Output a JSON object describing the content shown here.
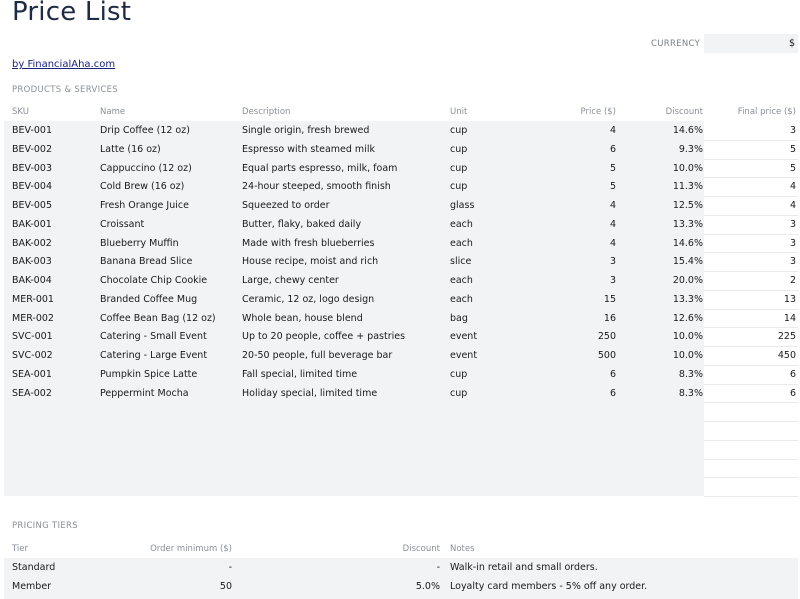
{
  "title": "Price List",
  "currency": {
    "label": "CURRENCY",
    "value": "$"
  },
  "byline": "by FinancialAha.com",
  "products_section_label": "PRODUCTS & SERVICES",
  "products_headers": {
    "sku": "SKU",
    "name": "Name",
    "description": "Description",
    "unit": "Unit",
    "price": "Price ($)",
    "discount": "Discount",
    "final": "Final price ($)"
  },
  "products": [
    {
      "sku": "BEV-001",
      "name": "Drip Coffee (12 oz)",
      "description": "Single origin, fresh brewed",
      "unit": "cup",
      "price": "4",
      "discount": "14.6%",
      "final": "3"
    },
    {
      "sku": "BEV-002",
      "name": "Latte (16 oz)",
      "description": "Espresso with steamed milk",
      "unit": "cup",
      "price": "6",
      "discount": "9.3%",
      "final": "5"
    },
    {
      "sku": "BEV-003",
      "name": "Cappuccino (12 oz)",
      "description": "Equal parts espresso, milk, foam",
      "unit": "cup",
      "price": "5",
      "discount": "10.0%",
      "final": "5"
    },
    {
      "sku": "BEV-004",
      "name": "Cold Brew (16 oz)",
      "description": "24-hour steeped, smooth finish",
      "unit": "cup",
      "price": "5",
      "discount": "11.3%",
      "final": "4"
    },
    {
      "sku": "BEV-005",
      "name": "Fresh Orange Juice",
      "description": "Squeezed to order",
      "unit": "glass",
      "price": "4",
      "discount": "12.5%",
      "final": "4"
    },
    {
      "sku": "BAK-001",
      "name": "Croissant",
      "description": "Butter, flaky, baked daily",
      "unit": "each",
      "price": "4",
      "discount": "13.3%",
      "final": "3"
    },
    {
      "sku": "BAK-002",
      "name": "Blueberry Muffin",
      "description": "Made with fresh blueberries",
      "unit": "each",
      "price": "4",
      "discount": "14.6%",
      "final": "3"
    },
    {
      "sku": "BAK-003",
      "name": "Banana Bread Slice",
      "description": "House recipe, moist and rich",
      "unit": "slice",
      "price": "3",
      "discount": "15.4%",
      "final": "3"
    },
    {
      "sku": "BAK-004",
      "name": "Chocolate Chip Cookie",
      "description": "Large, chewy center",
      "unit": "each",
      "price": "3",
      "discount": "20.0%",
      "final": "2"
    },
    {
      "sku": "MER-001",
      "name": "Branded Coffee Mug",
      "description": "Ceramic, 12 oz, logo design",
      "unit": "each",
      "price": "15",
      "discount": "13.3%",
      "final": "13"
    },
    {
      "sku": "MER-002",
      "name": "Coffee Bean Bag (12 oz)",
      "description": "Whole bean, house blend",
      "unit": "bag",
      "price": "16",
      "discount": "12.6%",
      "final": "14"
    },
    {
      "sku": "SVC-001",
      "name": "Catering - Small Event",
      "description": "Up to 20 people, coffee + pastries",
      "unit": "event",
      "price": "250",
      "discount": "10.0%",
      "final": "225"
    },
    {
      "sku": "SVC-002",
      "name": "Catering - Large Event",
      "description": "20-50 people, full beverage bar",
      "unit": "event",
      "price": "500",
      "discount": "10.0%",
      "final": "450"
    },
    {
      "sku": "SEA-001",
      "name": "Pumpkin Spice Latte",
      "description": "Fall special, limited time",
      "unit": "cup",
      "price": "6",
      "discount": "8.3%",
      "final": "6"
    },
    {
      "sku": "SEA-002",
      "name": "Peppermint Mocha",
      "description": "Holiday special, limited time",
      "unit": "cup",
      "price": "6",
      "discount": "8.3%",
      "final": "6"
    }
  ],
  "tiers_section_label": "PRICING TIERS",
  "tiers_headers": {
    "tier": "Tier",
    "order_min": "Order minimum ($)",
    "discount": "Discount",
    "notes": "Notes"
  },
  "tiers": [
    {
      "tier": "Standard",
      "order_min": "-",
      "discount": "-",
      "notes": "Walk-in retail and small orders."
    },
    {
      "tier": "Member",
      "order_min": "50",
      "discount": "5.0%",
      "notes": "Loyalty card members - 5% off any order."
    }
  ]
}
